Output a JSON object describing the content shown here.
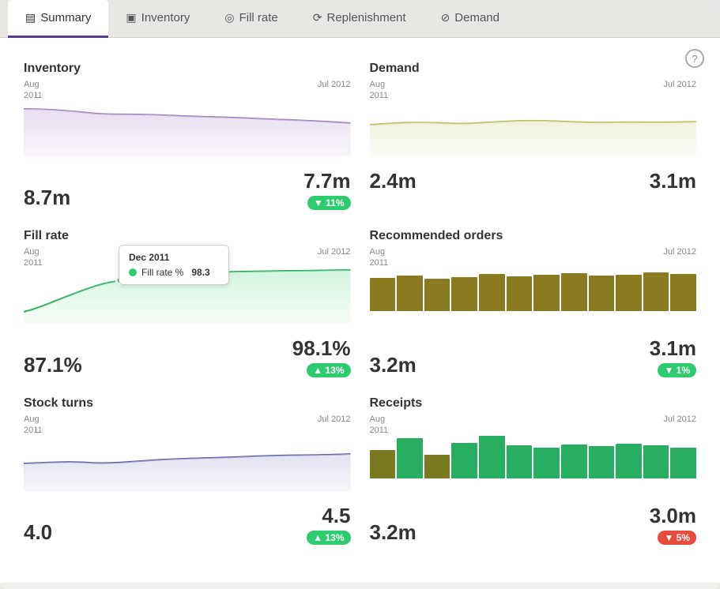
{
  "tabs": [
    {
      "id": "summary",
      "label": "Summary",
      "icon": "▤",
      "active": true
    },
    {
      "id": "inventory",
      "label": "Inventory",
      "icon": "▣",
      "active": false
    },
    {
      "id": "fill-rate",
      "label": "Fill rate",
      "icon": "⊕",
      "active": false
    },
    {
      "id": "replenishment",
      "label": "Replenishment",
      "icon": "⟳",
      "active": false
    },
    {
      "id": "demand",
      "label": "Demand",
      "icon": "⊘",
      "active": false
    }
  ],
  "help_icon": "?",
  "metrics": {
    "inventory": {
      "title": "Inventory",
      "start_label": "Aug\n2011",
      "end_label": "Jul 2012",
      "start_value": "8.7m",
      "end_value": "7.7m",
      "badge": "▼ 11%",
      "badge_type": "down_green"
    },
    "demand": {
      "title": "Demand",
      "start_label": "Aug\n2011",
      "end_label": "Jul 2012",
      "start_value": "2.4m",
      "end_value": "3.1m",
      "badge": "",
      "badge_type": "none"
    },
    "fill_rate": {
      "title": "Fill rate",
      "start_label": "Aug\n2011",
      "end_label": "Jul 2012",
      "start_value": "87.1%",
      "end_value": "98.1%",
      "badge": "▲ 13%",
      "badge_type": "up_green"
    },
    "recommended_orders": {
      "title": "Recommended orders",
      "start_label": "Aug\n2011",
      "end_label": "Jul 2012",
      "start_value": "3.2m",
      "end_value": "3.1m",
      "badge": "▼ 1%",
      "badge_type": "down_green"
    },
    "stock_turns": {
      "title": "Stock turns",
      "start_label": "Aug\n2011",
      "end_label": "Jul 2012",
      "start_value": "4.0",
      "end_value": "4.5",
      "badge": "▲ 13%",
      "badge_type": "up_green"
    },
    "receipts": {
      "title": "Receipts",
      "start_label": "Aug\n2011",
      "end_label": "Jul 2012",
      "start_value": "3.2m",
      "end_value": "3.0m",
      "badge": "▼ 5%",
      "badge_type": "down_red"
    }
  },
  "tooltip": {
    "date": "Dec 2011",
    "label": "Fill rate %",
    "value": "98.3"
  }
}
